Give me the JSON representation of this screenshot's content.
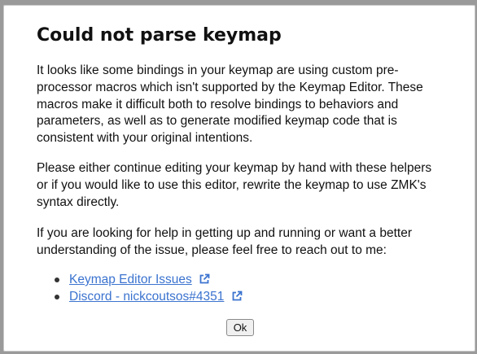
{
  "dialog": {
    "title": "Could not parse keymap",
    "paragraphs": [
      "It looks like some bindings in your keymap are using custom pre-processor macros which isn't supported by the Keymap Editor. These macros make it difficult both to resolve bindings to behaviors and parameters, as well as to generate modified keymap code that is consistent with your original intentions.",
      "Please either continue editing your keymap by hand with these helpers or if you would like to use this editor, rewrite the keymap to use ZMK's syntax directly.",
      "If you are looking for help in getting up and running or want a better understanding of the issue, please feel free to reach out to me:"
    ],
    "links": [
      {
        "label": "Keymap Editor Issues",
        "icon": "external-link-icon"
      },
      {
        "label": "Discord - nickcoutsos#4351",
        "icon": "external-link-icon"
      }
    ],
    "ok_label": "Ok"
  },
  "colors": {
    "link": "#3b73cf",
    "backdrop": "#9a9a9a",
    "dialog_bg": "#ffffff"
  }
}
